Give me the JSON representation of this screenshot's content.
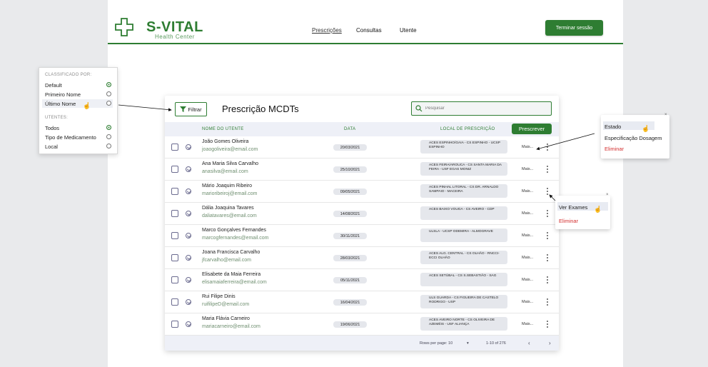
{
  "header": {
    "brand": "S-VITAL",
    "brand_sub": "Health Center",
    "nav": [
      "Prescrições",
      "Consultas",
      "Utente"
    ],
    "logout": "Terminar sessão"
  },
  "sort_popup": {
    "sort_title": "CLASSIFICADO POR:",
    "sort_options": [
      "Default",
      "Primeiro Nome",
      "Último Nome"
    ],
    "filter_title": "UTENTES:",
    "filter_options": [
      "Todos",
      "Tipo de Medicamento",
      "Local"
    ]
  },
  "card": {
    "filter_label": "Filtrar",
    "title": "Prescrição MCDTs",
    "search_placeholder": "Pesquisar",
    "columns": [
      "NOME DO UTENTE",
      "DATA",
      "LOCAL DE PRESCRIÇÃO"
    ],
    "prescribe": "Prescrever",
    "more_label": "Mais...",
    "rows": [
      {
        "name": "João Gomes Oliveira",
        "email": "joaogoliveira@email.com",
        "date": "20/03/2021",
        "location": "ACES ESPINHO/GAIA - CS ESPINHO - UCSP ESPINHO"
      },
      {
        "name": "Ana Maria Silva Carvalho",
        "email": "anasilva@email.com",
        "date": "25/10/2021",
        "location": "ACES FEIRA/AROUCA - CS SANTA MARIA DA FEIRA - USF EGAS MONIZ"
      },
      {
        "name": "Mário Joaquim Ribeiro",
        "email": "marioribeiroj@email.com",
        "date": "09/05/2021",
        "location": "ACES PINHAL LITORAL - CS DR. ARNALDO SAMPAIO - MACEIRA"
      },
      {
        "name": "Dália Joaquina Tavares",
        "email": "daliatavares@email.com",
        "date": "14/08/2021",
        "location": "ACES BAIXO VOUGA - CS AVEIRO - CDP"
      },
      {
        "name": "Marco Gonçalves Fernandes",
        "email": "marcogfernandes@email.com",
        "date": "30/11/2021",
        "location": "ULSLA - UCSP ODEMIRA - ALMOGRAVE"
      },
      {
        "name": "Joana Francisca Carvalho",
        "email": "jfcarvalho@email.com",
        "date": "28/03/2021",
        "location": "ACES ALG. CENTRAL - CS OLHÃO - RNCCI-ECCI OLHÃO"
      },
      {
        "name": "Elisabete da Maia Ferreira",
        "email": "elisamaiaferreira@email.com",
        "date": "05/11/2021",
        "location": "ACES SETÚBAL - CS S.SEBASTIÃO - SAG"
      },
      {
        "name": "Rui Filipe Dinis",
        "email": "ruifilipeD@email.com",
        "date": "16/04/2021",
        "location": "ULS GUARDA - CS FIGUEIRA DE CASTELO RODRIGO - USP"
      },
      {
        "name": "Maria Flávia Carneiro",
        "email": "mariacarneiro@email.com",
        "date": "19/06/2021",
        "location": "ACES AVEIRO NORTE - CS OLIVEIRA DE AZEMÉIS - USF ALIANÇA"
      }
    ],
    "rows_per_page": "Rows per page: 10",
    "range": "1-10 of 276"
  },
  "menu_more": {
    "items": [
      "Estado",
      "Especificação Dosagem",
      "Eliminar"
    ]
  },
  "menu_kebab": {
    "items": [
      "Ver Exames",
      "Eliminar"
    ]
  },
  "icons": {
    "brand_color": "#2e7d32",
    "danger_color": "#d32f2f"
  }
}
